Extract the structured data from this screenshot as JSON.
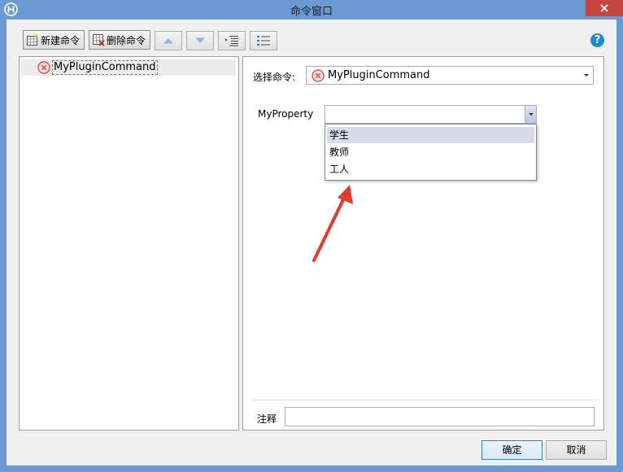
{
  "window": {
    "title": "命令窗口"
  },
  "toolbar": {
    "new_label": "新建命令",
    "delete_label": "删除命令"
  },
  "tree": {
    "items": [
      {
        "label": "MyPluginCommand"
      }
    ]
  },
  "form": {
    "command_label": "选择命令:",
    "command_value": "MyPluginCommand",
    "property_label": "MyProperty",
    "property_value": "",
    "property_options": [
      "学生",
      "教师",
      "工人"
    ],
    "note_label": "注释",
    "note_value": ""
  },
  "footer": {
    "ok_label": "确定",
    "cancel_label": "取消"
  },
  "colors": {
    "titlebar": "#6b9ad3",
    "close": "#c7473e",
    "error_icon": "#d9534f",
    "annotation_arrow": "#e53a2a"
  }
}
